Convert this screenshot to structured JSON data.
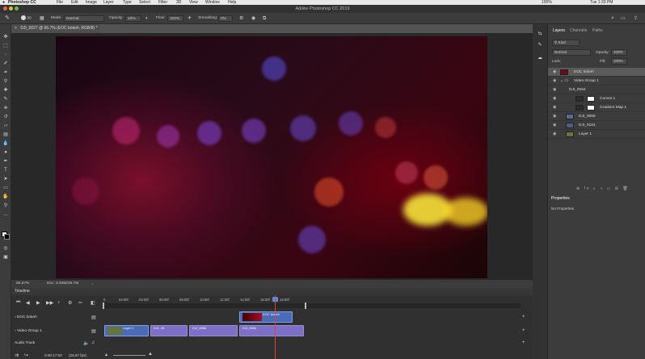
{
  "menubar": {
    "app": "Photoshop CC",
    "items": [
      "File",
      "Edit",
      "Image",
      "Layer",
      "Type",
      "Select",
      "Filter",
      "3D",
      "View",
      "Window",
      "Help"
    ],
    "right_text": "100%",
    "clock": "Tue 1:33 PM"
  },
  "window_title": "Adobe Photoshop CC 2019",
  "options": {
    "mode_label": "Mode:",
    "mode_value": "Normal",
    "opacity_label": "Opacity:",
    "opacity_value": "10%",
    "flow_label": "Flow:",
    "flow_value": "100%",
    "smoothing_label": "Smoothing:",
    "smoothing_value": "0%",
    "brush_size": "30"
  },
  "document_tab": "DJI_0027 @ 66.7% (EOC bokeh, RGB/8) *",
  "status": {
    "zoom": "66.67%",
    "doc_size": "Doc: 5.93M/29.7M"
  },
  "timeline": {
    "title": "Timeline",
    "ruler": [
      "02:00f",
      "04:00f",
      "06:00f",
      "08:00f",
      "10:00f",
      "12:00f",
      "14:00f",
      "16:00f",
      "18:00f"
    ],
    "tracks": [
      "EOC bokeh",
      "Video Group 1",
      "Audio Track"
    ],
    "clips": {
      "eoc": "EOC bokeh",
      "layer1": "Layer 1",
      "dji1": "DJI...81",
      "dji2": "DJI_0658",
      "dji3": "DJI_0064"
    },
    "timecode": "0:00:17:00",
    "fps": "(29.97 fps)"
  },
  "layers_panel": {
    "tabs": [
      "Layers",
      "Channels",
      "Paths"
    ],
    "kind_label": "Kind",
    "blend_mode": "Normal",
    "opacity_label": "Opacity:",
    "opacity_value": "100%",
    "lock_label": "Lock:",
    "fill_label": "Fill:",
    "fill_value": "100%",
    "layers": [
      {
        "name": "EOC bokeh"
      },
      {
        "name": "Video Group 1"
      },
      {
        "name": "DJI_0064"
      },
      {
        "name": "Curves 1"
      },
      {
        "name": "Gradient Map 1"
      },
      {
        "name": "DJI_0658"
      },
      {
        "name": "DJI_0181"
      },
      {
        "name": "Layer 1"
      }
    ]
  },
  "properties_panel": {
    "title": "Properties",
    "empty_text": "No Properties"
  }
}
